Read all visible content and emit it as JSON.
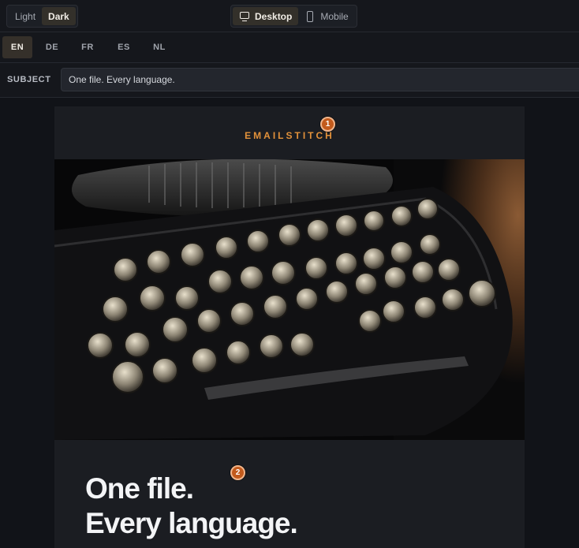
{
  "toolbar": {
    "theme_options": [
      {
        "label": "Light",
        "active": false
      },
      {
        "label": "Dark",
        "active": true
      }
    ],
    "view_options": [
      {
        "label": "Desktop",
        "icon": "desktop-icon",
        "active": true
      },
      {
        "label": "Mobile",
        "icon": "mobile-icon",
        "active": false
      }
    ]
  },
  "languages": [
    {
      "code": "EN",
      "active": true
    },
    {
      "code": "DE",
      "active": false
    },
    {
      "code": "FR",
      "active": false
    },
    {
      "code": "ES",
      "active": false
    },
    {
      "code": "NL",
      "active": false
    }
  ],
  "subject": {
    "label": "SUBJECT",
    "value": "One file. Every language."
  },
  "email": {
    "brand": "EMAILSTITCH",
    "hero_image": "typewriter-photo",
    "headline_line1": "One file.",
    "headline_line2": "Every language."
  },
  "markers": [
    {
      "number": "1"
    },
    {
      "number": "2"
    }
  ],
  "colors": {
    "accent": "#e2913a",
    "marker": "#c25a1c",
    "background": "#111318"
  }
}
